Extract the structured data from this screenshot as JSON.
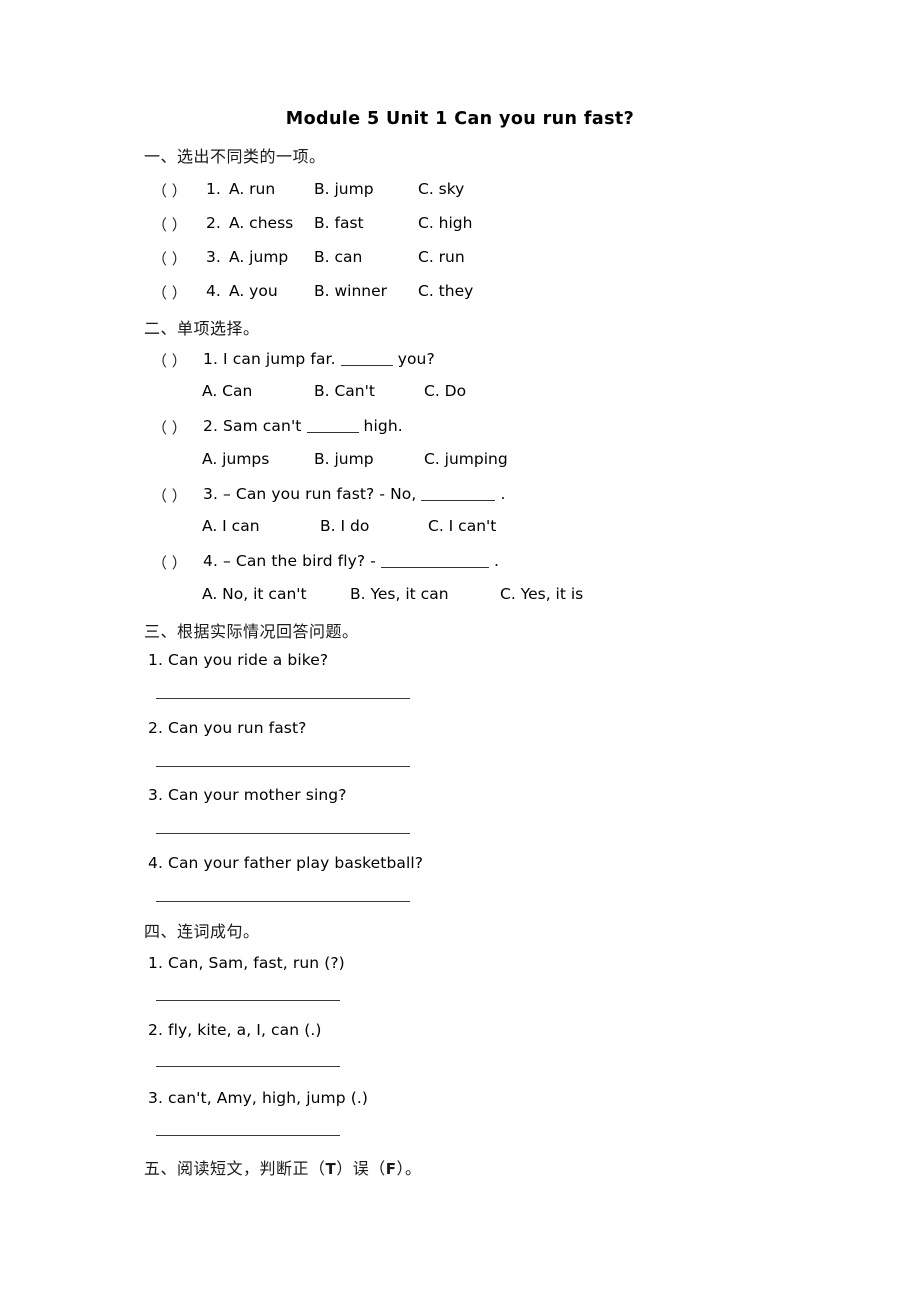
{
  "document": {
    "title": "Module 5 Unit 1 Can you run fast?"
  },
  "sections": [
    {
      "id": "section-one",
      "heading": "一、选出不同类的一项。",
      "bracket": "（    ）",
      "items": [
        {
          "num": "1.",
          "a": "A. run",
          "b": "B. jump",
          "c": "C. sky"
        },
        {
          "num": "2.",
          "a": "A. chess",
          "b": "B. fast",
          "c": "C. high"
        },
        {
          "num": "3.",
          "a": "A. jump",
          "b": "B. can",
          "c": "C. run"
        },
        {
          "num": "4.",
          "a": "A. you",
          "b": "B. winner",
          "c": "C. they"
        }
      ]
    },
    {
      "id": "section-two",
      "heading": "二、单项选择。",
      "bracket": "（    ）",
      "items": [
        {
          "num": "1.",
          "stem_before": "I can jump far.",
          "stem_after": "you?",
          "a": "A. Can",
          "b": "B. Can't",
          "c": "C. Do"
        },
        {
          "num": "2.",
          "stem_before": "Sam can't",
          "stem_after": "high.",
          "a": "A. jumps",
          "b": "B. jump",
          "c": "C. jumping"
        },
        {
          "num": "3.",
          "stem_before": "– Can you run fast?   - No,",
          "stem_after": ".",
          "a": "A. I can",
          "b": "B. I do",
          "c": "C. I can't"
        },
        {
          "num": "4.",
          "stem_before": "– Can the bird fly?   -",
          "stem_after": ".",
          "a": "A. No, it can't",
          "b": "B. Yes, it can",
          "c": "C. Yes, it is"
        }
      ]
    },
    {
      "id": "section-three",
      "heading": "三、根据实际情况回答问题。",
      "items": [
        {
          "text": "1. Can you ride a bike?"
        },
        {
          "text": "2. Can you run fast?"
        },
        {
          "text": "3. Can your mother sing?"
        },
        {
          "text": "4. Can your father play basketball?"
        }
      ]
    },
    {
      "id": "section-four",
      "heading": "四、连词成句。",
      "items": [
        {
          "text": "1. Can, Sam, fast, run (?)"
        },
        {
          "text": "2. fly, kite, a, I, can (.)"
        },
        {
          "text": "3. can't, Amy, high, jump (.)"
        }
      ]
    },
    {
      "id": "section-five",
      "heading_prefix": "五、阅读短文，判断正（",
      "heading_t": "T",
      "heading_mid": "）误（",
      "heading_f": "F",
      "heading_suffix": "）。"
    }
  ]
}
